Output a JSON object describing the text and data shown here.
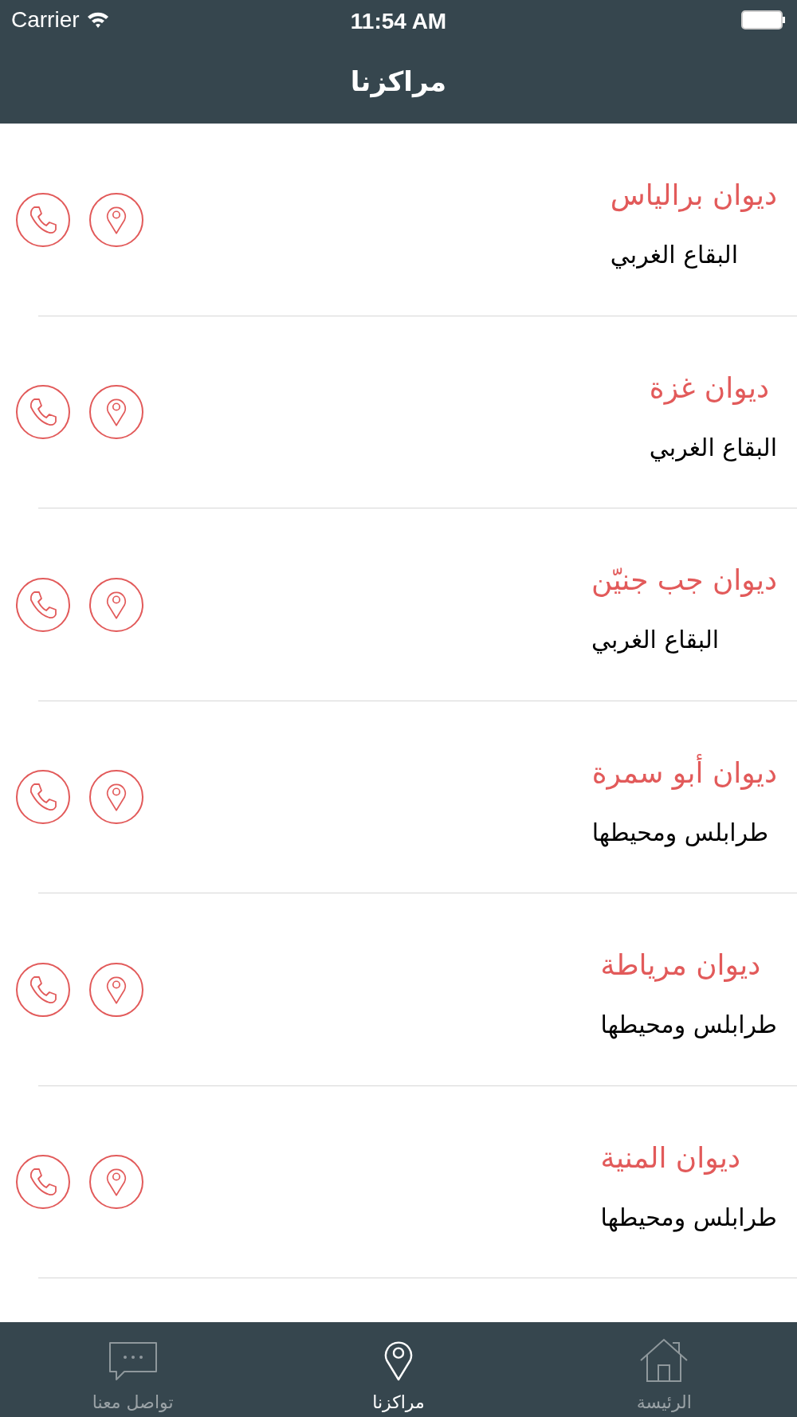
{
  "status_bar": {
    "carrier": "Carrier",
    "time": "11:54 AM"
  },
  "nav": {
    "title": "مراكزنا"
  },
  "centers": [
    {
      "name": "ديوان برالياس",
      "region": "البقاع الغربي"
    },
    {
      "name": "ديوان غزة",
      "region": "البقاع الغربي"
    },
    {
      "name": "ديوان جب جنيّن",
      "region": "البقاع الغربي"
    },
    {
      "name": "ديوان أبو سمرة",
      "region": "طرابلس ومحيطها"
    },
    {
      "name": "ديوان مرياطة",
      "region": "طرابلس ومحيطها"
    },
    {
      "name": "ديوان المنية",
      "region": "طرابلس ومحيطها"
    }
  ],
  "tabs": [
    {
      "label": "الرئيسة",
      "kind": "home",
      "selected": false
    },
    {
      "label": "مراكزنا",
      "kind": "pin",
      "selected": true
    },
    {
      "label": "تواصل معنا",
      "kind": "chat",
      "selected": false
    }
  ]
}
